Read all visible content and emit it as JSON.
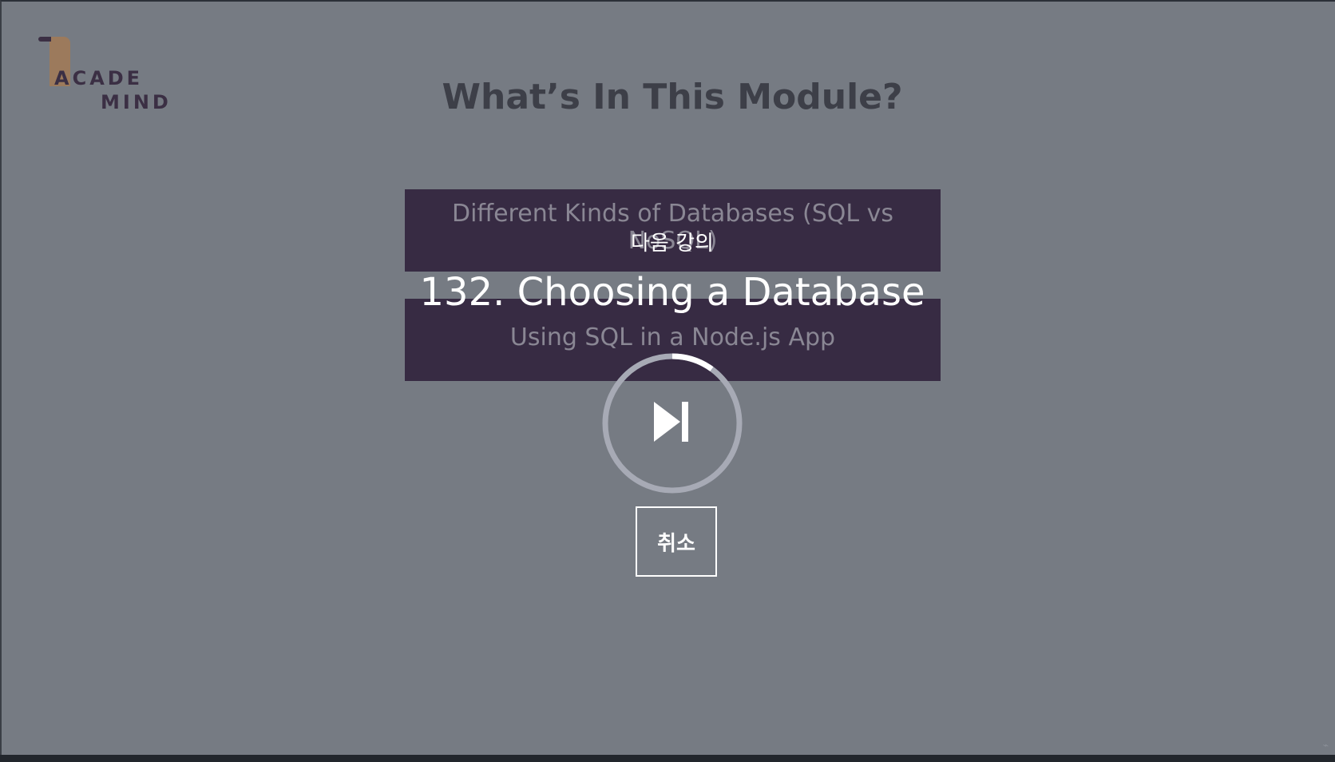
{
  "logo": {
    "line1": "ACADE",
    "line2": "MIND"
  },
  "slide": {
    "title": "What’s In This Module?",
    "items": [
      "Different Kinds of Databases (SQL vs NoSQL)",
      "Using SQL in a Node.js App"
    ]
  },
  "overlay": {
    "next_label": "다음 강의",
    "next_title": "132. Choosing a Database",
    "autoplay_progress": 0.1,
    "cancel_label": "취소"
  },
  "colors": {
    "overlay_bg": "#767b83",
    "slide_box": "#372b43",
    "ring_track": "#a7aab5",
    "ring_progress": "#ffffff"
  },
  "icons": {
    "autoplay": "skip-next-icon",
    "watermark": "udemy-icon"
  }
}
